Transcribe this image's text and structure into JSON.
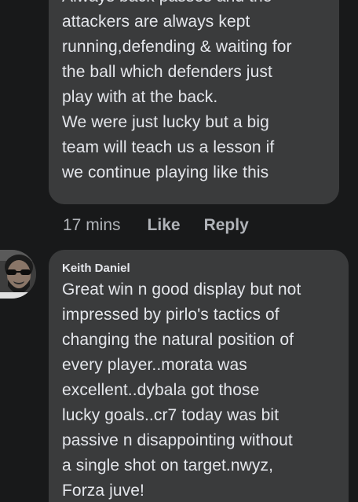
{
  "comment_1": {
    "text": "Always back passes and the\nattackers are always kept\nrunning,defending & waiting for\nthe ball which defenders just\nplay with at the back.\nWe were just lucky but a big\nteam will teach us a lesson if\nwe continue playing like this",
    "time": "17 mins",
    "like_label": "Like",
    "reply_label": "Reply"
  },
  "comment_2": {
    "author": "Keith Daniel",
    "avatar_icon": "profile-photo-avatar",
    "text": "Great win n good display but not\nimpressed by pirlo's tactics of\nchanging the natural position of\nevery player..morata was\nexcellent..dybala got those\nlucky goals..cr7 today was bit\npassive n disappointing without\na single shot on target.nwyz,\nForza juve!"
  },
  "colors": {
    "background": "#18191a",
    "bubble": "#3a3b3c",
    "text_primary": "#e4e6eb",
    "text_secondary": "#b0b3b8"
  }
}
